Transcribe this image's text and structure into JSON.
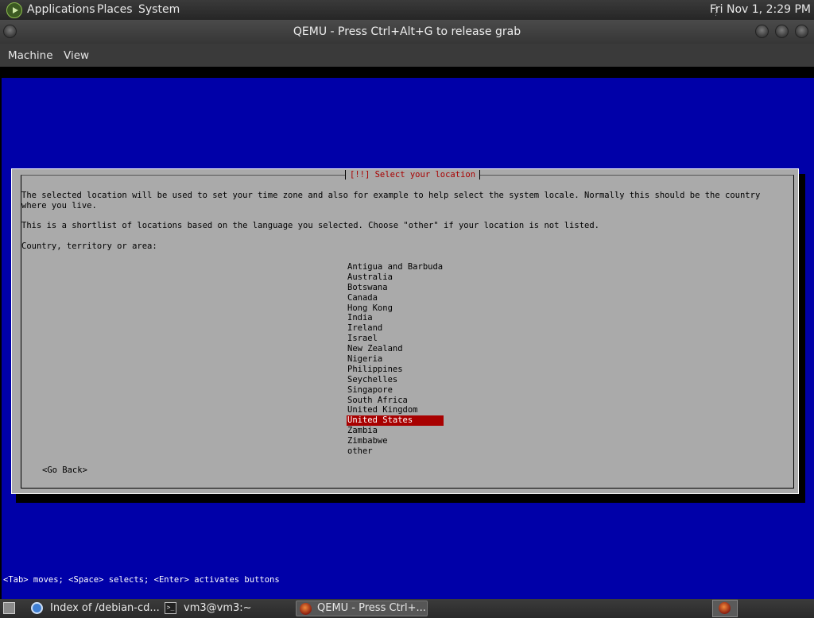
{
  "top_panel": {
    "menus": [
      "Applications",
      "Places",
      "System"
    ],
    "clock": "Fri Nov 1,  2:29 PM"
  },
  "window": {
    "title": "QEMU - Press Ctrl+Alt+G to release grab",
    "menu": [
      "Machine",
      "View"
    ]
  },
  "installer": {
    "dialog_title": "[!!] Select your location",
    "paragraph1": "The selected location will be used to set your time zone and also for example to help select the system locale. Normally this should be the country where you live.",
    "paragraph2": "This is a shortlist of locations based on the language you selected. Choose \"other\" if your location is not listed.",
    "prompt": "Country, territory or area:",
    "countries": [
      "Antigua and Barbuda",
      "Australia",
      "Botswana",
      "Canada",
      "Hong Kong",
      "India",
      "Ireland",
      "Israel",
      "New Zealand",
      "Nigeria",
      "Philippines",
      "Seychelles",
      "Singapore",
      "South Africa",
      "United Kingdom",
      "United States",
      "Zambia",
      "Zimbabwe",
      "other"
    ],
    "selected_country": "United States",
    "go_back": "<Go Back>",
    "help_line": "<Tab> moves; <Space> selects; <Enter> activates buttons",
    "colors": {
      "background": "#0000a8",
      "dialog": "#aaaaaa",
      "highlight": "#a80000",
      "title_text": "#a80000"
    }
  },
  "taskbar": {
    "tasks": [
      {
        "label": "Index of /debian-cd...",
        "icon": "browser-icon"
      },
      {
        "label": "vm3@vm3:~",
        "icon": "terminal-icon"
      },
      {
        "label": "QEMU - Press Ctrl+...",
        "icon": "qemu-icon",
        "active": true
      }
    ]
  }
}
